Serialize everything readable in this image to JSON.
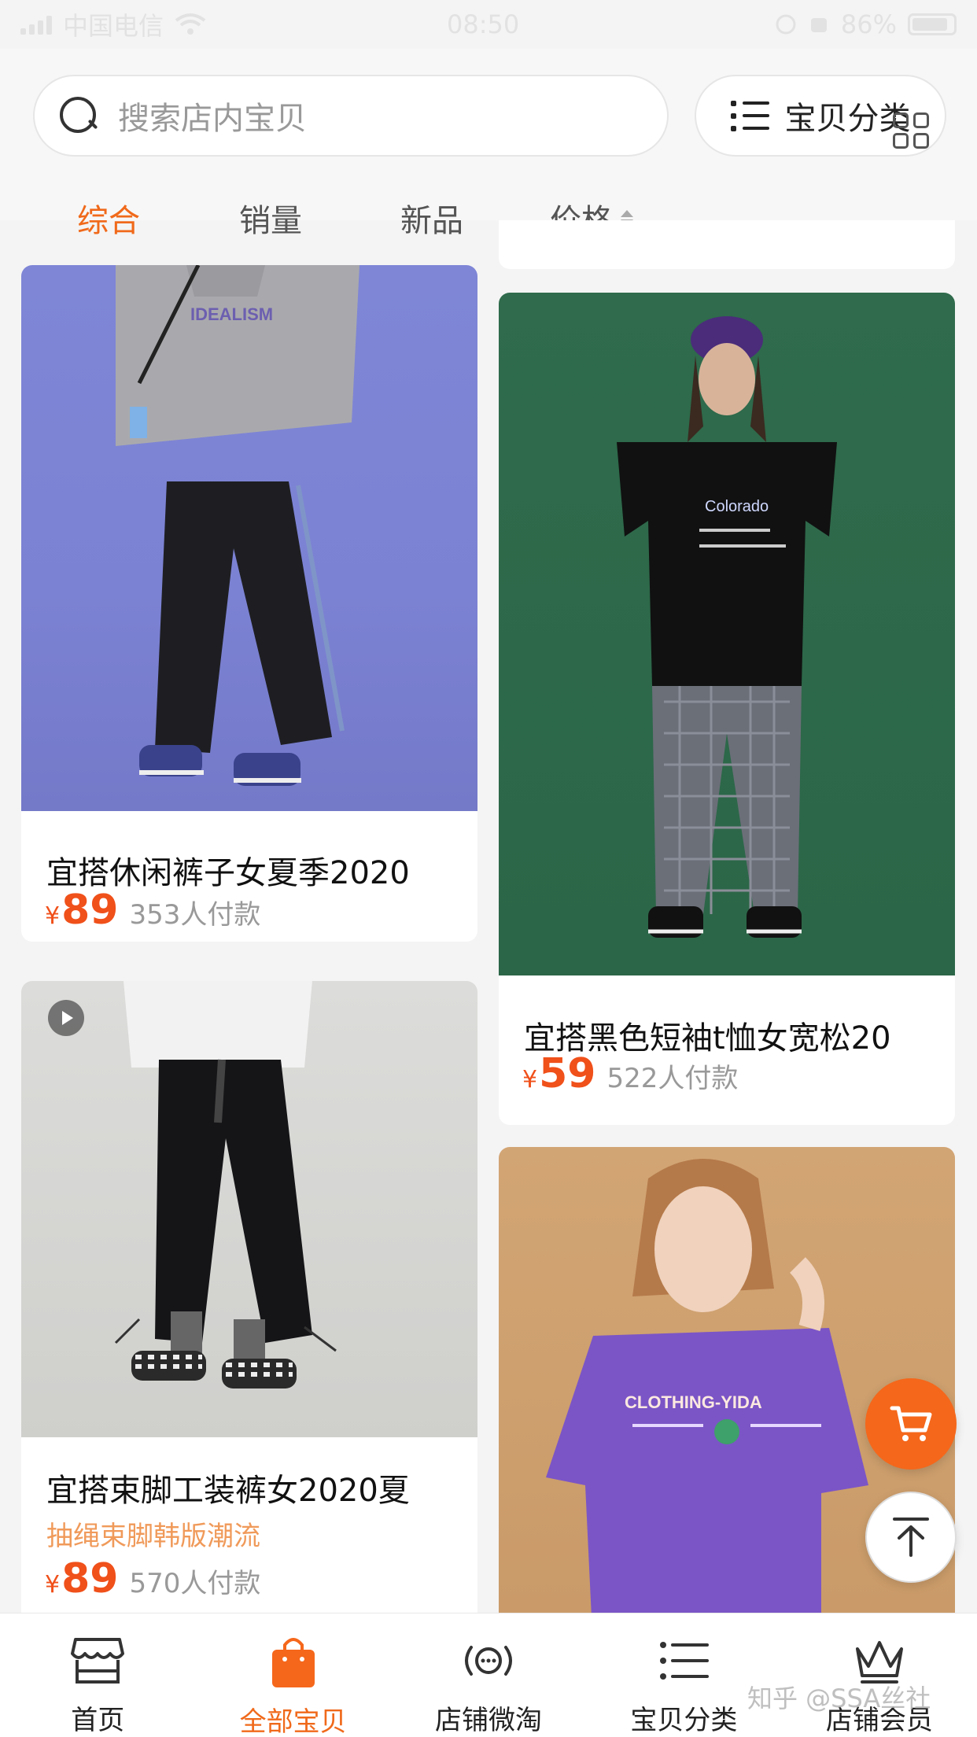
{
  "status_bar": {
    "carrier": "中国电信",
    "time": "08:50",
    "battery": "86%"
  },
  "header": {
    "search_placeholder": "搜索店内宝贝",
    "category_label": "宝贝分类"
  },
  "sort_tabs": [
    {
      "label": "综合",
      "active": true
    },
    {
      "label": "销量",
      "active": false
    },
    {
      "label": "新品",
      "active": false
    },
    {
      "label": "价格",
      "active": false
    }
  ],
  "products": [
    {
      "title": "宜搭休闲裤子女夏季2020",
      "currency": "¥",
      "price": "89",
      "sold": "353人付款",
      "image": "model-grey-tee-black-track-pants"
    },
    {
      "title": "宜搭黑色短袖t恤女宽松20",
      "currency": "¥",
      "price": "59",
      "sold": "522人付款",
      "image": "model-black-tee-plaid-pants"
    },
    {
      "title": "宜搭束脚工装裤女2020夏",
      "subtitle": "抽绳束脚韩版潮流",
      "currency": "¥",
      "price": "89",
      "sold": "570人付款",
      "image": "model-black-cargo-pants",
      "has_video": true
    },
    {
      "image": "model-purple-tee",
      "print_text": "CLOTHING-YIDA"
    }
  ],
  "bottom_nav": [
    {
      "label": "首页",
      "icon": "store-icon",
      "active": false
    },
    {
      "label": "全部宝贝",
      "icon": "shopping-bag-icon",
      "active": true
    },
    {
      "label": "店铺微淘",
      "icon": "broadcast-icon",
      "active": false
    },
    {
      "label": "宝贝分类",
      "icon": "list-icon",
      "active": false
    },
    {
      "label": "店铺会员",
      "icon": "crown-icon",
      "active": false
    }
  ],
  "watermark": "知乎 @SSA丝社",
  "colors": {
    "accent": "#f0691a",
    "price": "#f0501a",
    "subtitle": "#f09a5a"
  }
}
